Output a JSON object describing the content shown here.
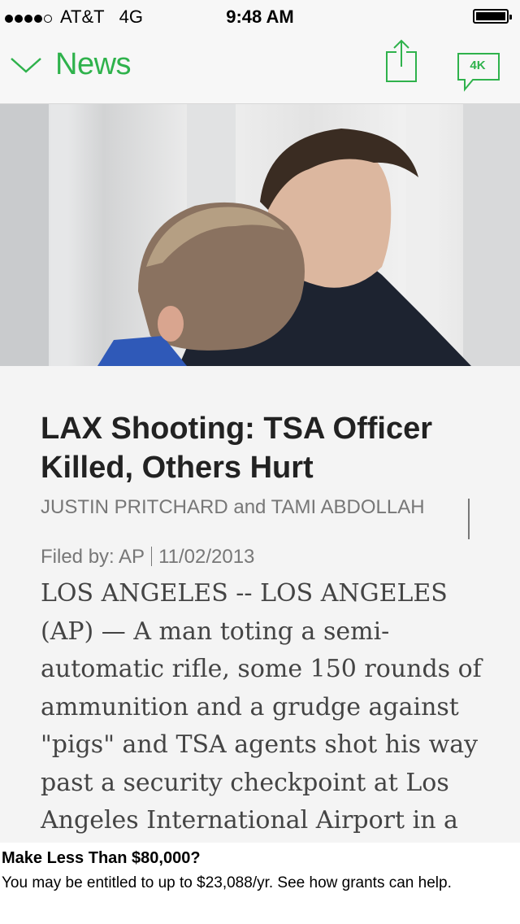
{
  "status_bar": {
    "carrier": "AT&T",
    "network": "4G",
    "time": "9:48 AM",
    "signal_bars": 4,
    "signal_max": 5,
    "battery_level": 1.0
  },
  "nav": {
    "title": "News",
    "comment_count": "4K",
    "accent_color": "#2fb24c",
    "icons": [
      "chevron-down-icon",
      "share-icon",
      "comment-icon"
    ]
  },
  "article": {
    "headline": "LAX Shooting: TSA Officer Killed, Others Hurt",
    "byline": "JUSTIN PRITCHARD and TAMI ABDOLLAH",
    "filed_by": "Filed by: AP",
    "date": "11/02/2013",
    "body": "LOS ANGELES -- LOS ANGELES (AP) — A man toting a semi-automatic rifle, some 150 rounds of ammunition and a grudge against \"pigs\" and TSA agents shot his way past a security checkpoint at Los Angeles International Airport in a"
  },
  "ad": {
    "title": "Make Less Than $80,000?",
    "description": "You may be entitled to up to $23,088/yr. See how grants can help."
  }
}
